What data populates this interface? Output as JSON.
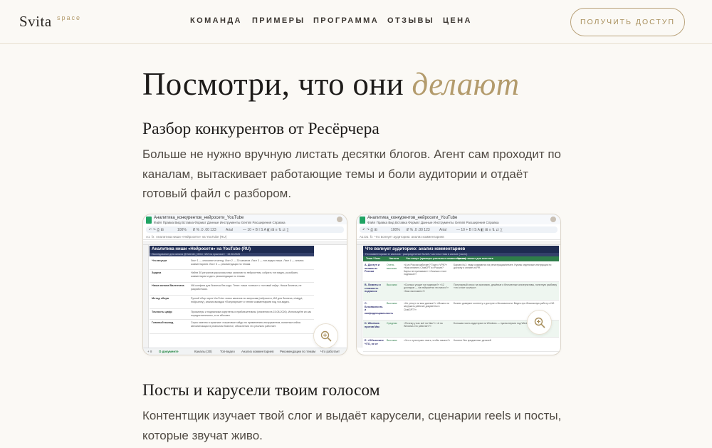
{
  "header": {
    "logo": "Svita",
    "logo_sup": "space",
    "nav": [
      "КОМАНДА",
      "ПРИМЕРЫ",
      "ПРОГРАММА",
      "ОТЗЫВЫ",
      "ЦЕНА"
    ],
    "cta": "ПОЛУЧИТЬ ДОСТУП"
  },
  "hero": {
    "title_main": "Посмотри, что они ",
    "title_accent": "делают"
  },
  "section1": {
    "title": "Разбор конкурентов от Ресёрчера",
    "text": "Больше не нужно вручную листать десятки блогов. Агент сам проходит по каналам, вытаскивает работающие темы и боли аудитории и отдаёт готовый файл с разбором."
  },
  "shot1": {
    "doc_title": "Аналитика_конкурентов_нейросети_YouTube",
    "menu": "Файл  Правка  Вид  Вставка  Формат  Данные  Инструменты  Gemini  Расширения  Справка",
    "toolbar_zoom": "100%",
    "toolbar_font": "Arial",
    "cell_ref": "A1",
    "formula": "Аналитика ниши «Нейросети» на YouTube (RU)",
    "banner": "Аналитика ниши «Нейросети» на YouTube (RU)",
    "sub": "Исследование для канала @Valentin_Miller «ИИ на практике» · 15.08.2026",
    "rows": [
      {
        "k": "Что внутри",
        "v": "Лист 1 — описание и метод. Лист 2 — 30 каналов. Лист 3 — топ-видео ниши. Лист 4 — анализ комментариев. Лист 5 — рекомендации по темам."
      },
      {
        "k": "Задача",
        "v": "Найти 30 ритуалов русскоязычных каналов по нейросетям, собрать топ видео, разобрать комментарии и дать рекомендации по темам."
      },
      {
        "k": "Ниша канала Валентина",
        "v": "ИИ-конфиги для бизнеса без кода. Телег: наши «ключи» к «готовый гайд». Ниша бизнеса, не разработчики."
      },
      {
        "k": "Метод сбора",
        "v": "Ручной сбор через YouTube: поиск каналов по запросам (нейросети, ИИ для бизнеса, chatgpt, midjourney), анализ вкладки «Популярные» и чтение комментариев под топ-видео."
      },
      {
        "k": "Точность цифр",
        "v": "Просмотры и подписчики округлены и приблизительны (значения на 15.08.2026). Используйте их как порядок величины, а не абсолют."
      },
      {
        "k": "Главный вывод",
        "v": "Спрос именно в практике: пошаговые гайды по применению инструментов, понятные кейсы автоматизации в реальном бизнесе, объяснения что реально работает."
      }
    ],
    "tabs": [
      "О документе",
      "Каналы (30)",
      "Топ-видео",
      "Анализ комментариев",
      "Рекомендации по темам",
      "Что работает"
    ]
  },
  "shot2": {
    "doc_title": "Аналитика_конкурентов_нейросети_YouTube",
    "menu": "Файл  Правка  Вид  Вставка  Формат  Данные  Инструменты  Gemini  Расширения  Справка",
    "toolbar_zoom": "100%",
    "toolbar_font": "Arial",
    "cell_ref": "A1:D1",
    "formula": "Что волнует аудиторию: анализ комментариев",
    "banner": "Что волнует аудиторию: анализ комментариев",
    "sub": "По комментариям 11 каналов · распределение болей / частоты тема в канале (часто)",
    "headers": [
      "Тема / боль",
      "Частота",
      "Что пишут (примеры реальных комментариев)",
      "Что это значит для контента"
    ],
    "rows": [
      {
        "c1": "А. Доступ и оплата из России",
        "c2": "Очень высокая",
        "c3": "«А из России работает? Тоже с VPN?» «Как оплатить ChatGPT из России? Карты не принимают» «Сколько стоит подписка?»",
        "c4": "Барьер №1: люди срываются на регистрации/оплате. Нужны отдельные инструкции по доступу и оплате из РФ."
      },
      {
        "c1": "В. Лимиты и стоимость подписок",
        "c2": "Высокая",
        "c3": "«Сколько уходит на подписки?» «12 долларов — на нейросетях это много?» «Как сэкономить?»",
        "c4": "Популярный спрос на экономию, дешёвые и бесплатные альтернативы, понятную разбивку «что стоит сколько»."
      },
      {
        "c1": "С. Безопасность и конфиденциальность",
        "c2": "Высокая",
        "c3": "«Не утекут ли мои данные?» «Можно ли загружать рабочие документы в ChatGPT?»",
        "c4": "Бизнес доверяет контенту о доступе и безопасности. Видео про безопасную работу с ИИ."
      },
      {
        "c1": "D. Windows против Mac",
        "c2": "Средняя",
        "c3": "«Почему у вас всё на Mac?» «А на Windows это работает?»",
        "c4": "Большая часть аудитории на Windows — нужны версии под Windows."
      },
      {
        "c1": "Е. «Объясните ЧТО, не к»",
        "c2": "Высокая",
        "c3": "«Что с нуля нужно знать, чтобы начать?»",
        "c4": "Контент без предметных деталей"
      }
    ],
    "tabs": [
      "О документе",
      "Каналы (30)",
      "Топ-видео",
      "Анализ комментариев",
      "Рекомендации по темам",
      "Что работает"
    ]
  },
  "section2": {
    "title": "Посты и карусели твоим голосом",
    "text": "Контентщик изучает твой слог и выдаёт карусели, сценарии reels и посты, которые звучат живо."
  }
}
